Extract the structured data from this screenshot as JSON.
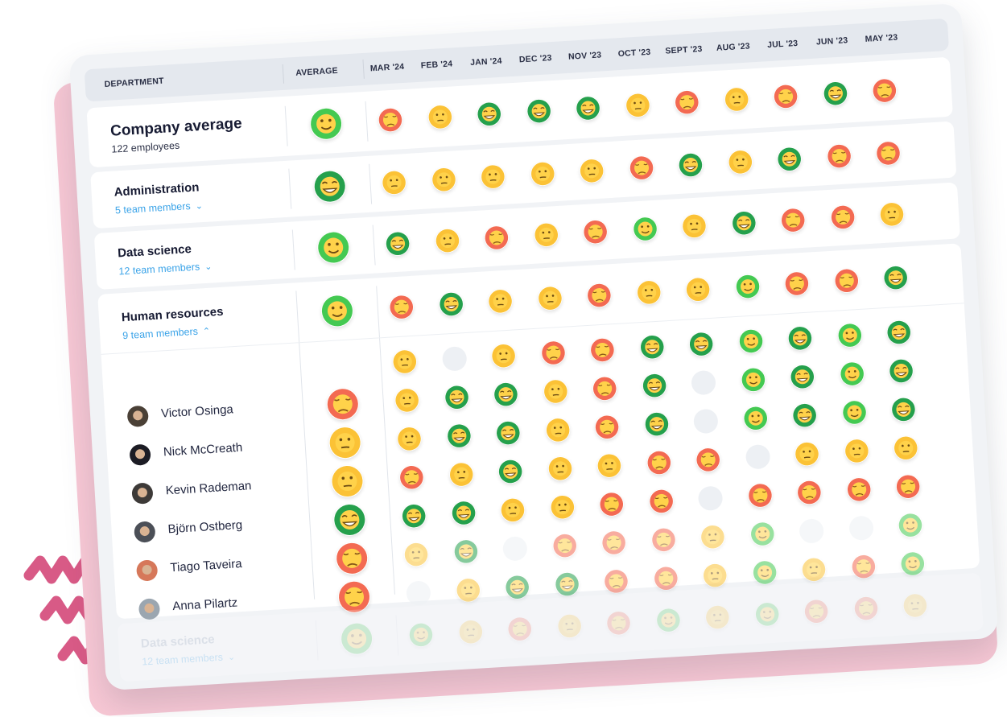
{
  "header": {
    "department": "DEPARTMENT",
    "average": "AVERAGE",
    "months": [
      "MAR '24",
      "FEB '24",
      "JAN '24",
      "DEC '23",
      "NOV '23",
      "OCT '23",
      "SEPT '23",
      "AUG '23",
      "JUL '23",
      "JUN '23",
      "MAY '23"
    ]
  },
  "colors": {
    "red": "#f36a52",
    "yellow": "#fbc236",
    "green": "#44c952",
    "darkgreen": "#25a04c",
    "empty": "#edf0f4",
    "link": "#3aa3e8"
  },
  "rows": [
    {
      "name": "Company average",
      "sub": "122 employees",
      "average": "green",
      "values": [
        "red",
        "yellow",
        "darkgreen",
        "darkgreen",
        "darkgreen",
        "yellow",
        "red",
        "yellow",
        "red",
        "darkgreen",
        "red"
      ]
    },
    {
      "name": "Administration",
      "sub": "5 team members",
      "average": "darkgreen",
      "values": [
        "yellow",
        "yellow",
        "yellow",
        "yellow",
        "yellow",
        "red",
        "darkgreen",
        "yellow",
        "darkgreen",
        "red",
        "red"
      ]
    },
    {
      "name": "Data science",
      "sub": "12 team members",
      "average": "green",
      "values": [
        "darkgreen",
        "yellow",
        "red",
        "yellow",
        "red",
        "green",
        "yellow",
        "darkgreen",
        "red",
        "red",
        "yellow"
      ]
    },
    {
      "name": "Human resources",
      "sub": "9 team members",
      "average": "green",
      "values": [
        "red",
        "darkgreen",
        "yellow",
        "yellow",
        "red",
        "yellow",
        "yellow",
        "green",
        "red",
        "red",
        "darkgreen"
      ]
    }
  ],
  "members": [
    {
      "name": "",
      "average": "",
      "values": [
        "yellow",
        "empty",
        "yellow",
        "red",
        "red",
        "darkgreen",
        "darkgreen",
        "green",
        "darkgreen",
        "green",
        "darkgreen"
      ]
    },
    {
      "name": "Victor Osinga",
      "average": "red",
      "values": [
        "yellow",
        "darkgreen",
        "darkgreen",
        "yellow",
        "red",
        "darkgreen",
        "empty",
        "green",
        "darkgreen",
        "green",
        "darkgreen"
      ]
    },
    {
      "name": "Nick McCreath",
      "average": "yellow",
      "values": [
        "yellow",
        "darkgreen",
        "darkgreen",
        "yellow",
        "red",
        "darkgreen",
        "empty",
        "green",
        "darkgreen",
        "green",
        "darkgreen"
      ]
    },
    {
      "name": "Kevin Rademan",
      "average": "yellow",
      "values": [
        "red",
        "yellow",
        "darkgreen",
        "yellow",
        "yellow",
        "red",
        "red",
        "empty",
        "yellow",
        "yellow",
        "yellow"
      ]
    },
    {
      "name": "Björn Ostberg",
      "average": "darkgreen",
      "values": [
        "darkgreen",
        "darkgreen",
        "yellow",
        "yellow",
        "red",
        "red",
        "empty",
        "red",
        "red",
        "red",
        "red"
      ]
    },
    {
      "name": "Tiago Taveira",
      "average": "red",
      "values": [
        "yellow",
        "darkgreen",
        "empty",
        "red",
        "red",
        "red",
        "yellow",
        "green",
        "empty",
        "empty",
        "green"
      ]
    },
    {
      "name": "Anna Pilartz",
      "average": "red",
      "values": [
        "empty",
        "yellow",
        "darkgreen",
        "darkgreen",
        "red",
        "red",
        "yellow",
        "green",
        "yellow",
        "red",
        "green"
      ]
    }
  ],
  "faded_row": {
    "name": "Data science",
    "sub": "12 team members",
    "average": "green",
    "values": [
      "green",
      "yellow",
      "red",
      "yellow",
      "red",
      "green",
      "yellow",
      "green",
      "red",
      "red",
      "yellow"
    ]
  }
}
